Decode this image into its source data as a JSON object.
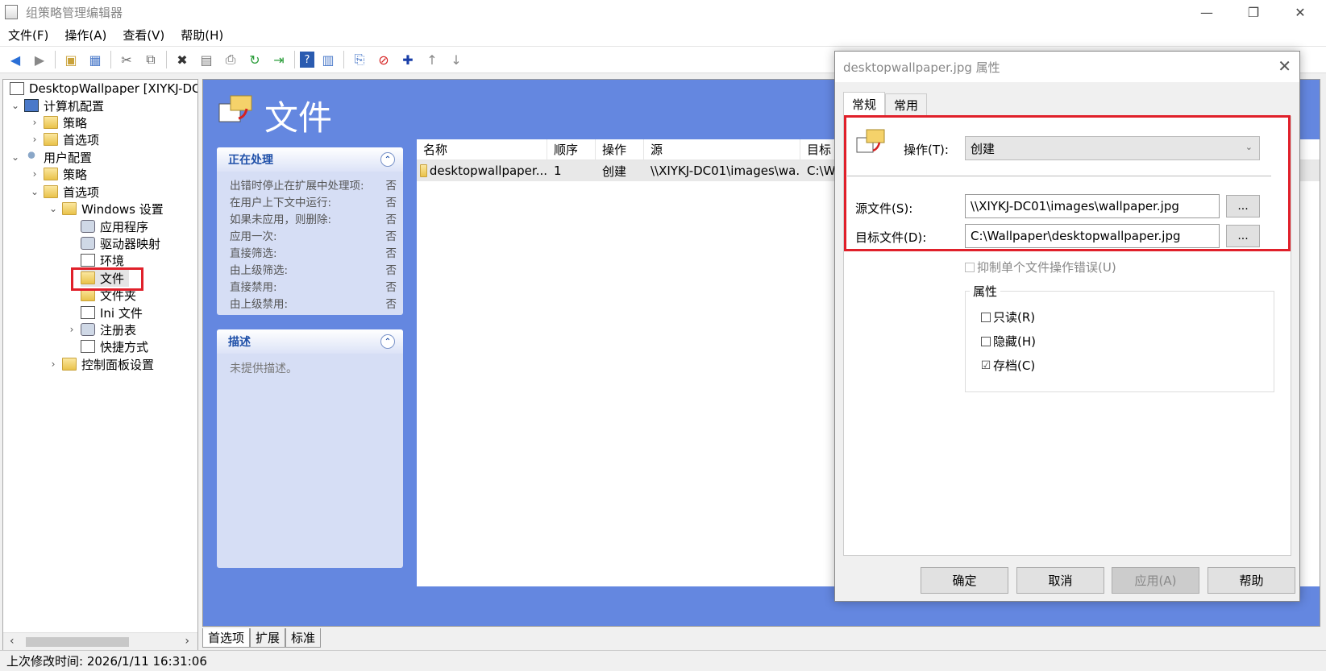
{
  "window": {
    "title": "组策略管理编辑器",
    "minimize_glyph": "—",
    "restore_glyph": "❐",
    "close_glyph": "✕"
  },
  "menu": [
    "文件(F)",
    "操作(A)",
    "查看(V)",
    "帮助(H)"
  ],
  "tree": {
    "root": "DesktopWallpaper [XIYKJ-DC0",
    "computer_config": "计算机配置",
    "cc_policies": "策略",
    "cc_preferences": "首选项",
    "user_config": "用户配置",
    "uc_policies": "策略",
    "uc_preferences": "首选项",
    "windows_settings": "Windows 设置",
    "applications": "应用程序",
    "drive_maps": "驱动器映射",
    "environment": "环境",
    "files": "文件",
    "folders": "文件夹",
    "ini_files": "Ini 文件",
    "registry": "注册表",
    "shortcuts": "快捷方式",
    "control_panel": "控制面板设置"
  },
  "main": {
    "title": "文件",
    "processing_panel": {
      "title": "正在处理",
      "rows": [
        {
          "label": "出错时停止在扩展中处理项:",
          "value": "否"
        },
        {
          "label": "在用户上下文中运行:",
          "value": "否"
        },
        {
          "label": "如果未应用，则删除:",
          "value": "否"
        },
        {
          "label": "应用一次:",
          "value": "否"
        },
        {
          "label": "直接筛选:",
          "value": "否"
        },
        {
          "label": "由上级筛选:",
          "value": "否"
        },
        {
          "label": "直接禁用:",
          "value": "否"
        },
        {
          "label": "由上级禁用:",
          "value": "否"
        }
      ]
    },
    "description_panel": {
      "title": "描述",
      "text": "未提供描述。"
    },
    "list": {
      "columns": [
        "名称",
        "顺序",
        "操作",
        "源",
        "目标"
      ],
      "rows": [
        {
          "name": "desktopwallpaper...",
          "order": "1",
          "action": "创建",
          "source": "\\\\XIYKJ-DC01\\images\\wa...",
          "target": "C:\\W"
        }
      ]
    }
  },
  "bottom_tabs": [
    "首选项",
    "扩展",
    "标准"
  ],
  "status": "上次修改时间: 2026/1/11 16:31:06",
  "dialog": {
    "title": "desktopwallpaper.jpg 属性",
    "tabs": [
      "常规",
      "常用"
    ],
    "action_label": "操作(T):",
    "action_value": "创建",
    "source_label": "源文件(S):",
    "source_value": "\\\\XIYKJ-DC01\\images\\wallpaper.jpg",
    "target_label": "目标文件(D):",
    "target_value": "C:\\Wallpaper\\desktopwallpaper.jpg",
    "browse_label": "...",
    "suppress_label": "抑制单个文件操作错误(U)",
    "attributes_title": "属性",
    "readonly_label": "只读(R)",
    "hidden_label": "隐藏(H)",
    "archive_label": "存档(C)",
    "check_mark": "☑",
    "ok": "确定",
    "cancel": "取消",
    "apply": "应用(A)",
    "help": "帮助"
  },
  "colors": {
    "main_bg": "#6487e0",
    "highlight": "#e0202a",
    "panel_title": "#1e4fa8"
  }
}
